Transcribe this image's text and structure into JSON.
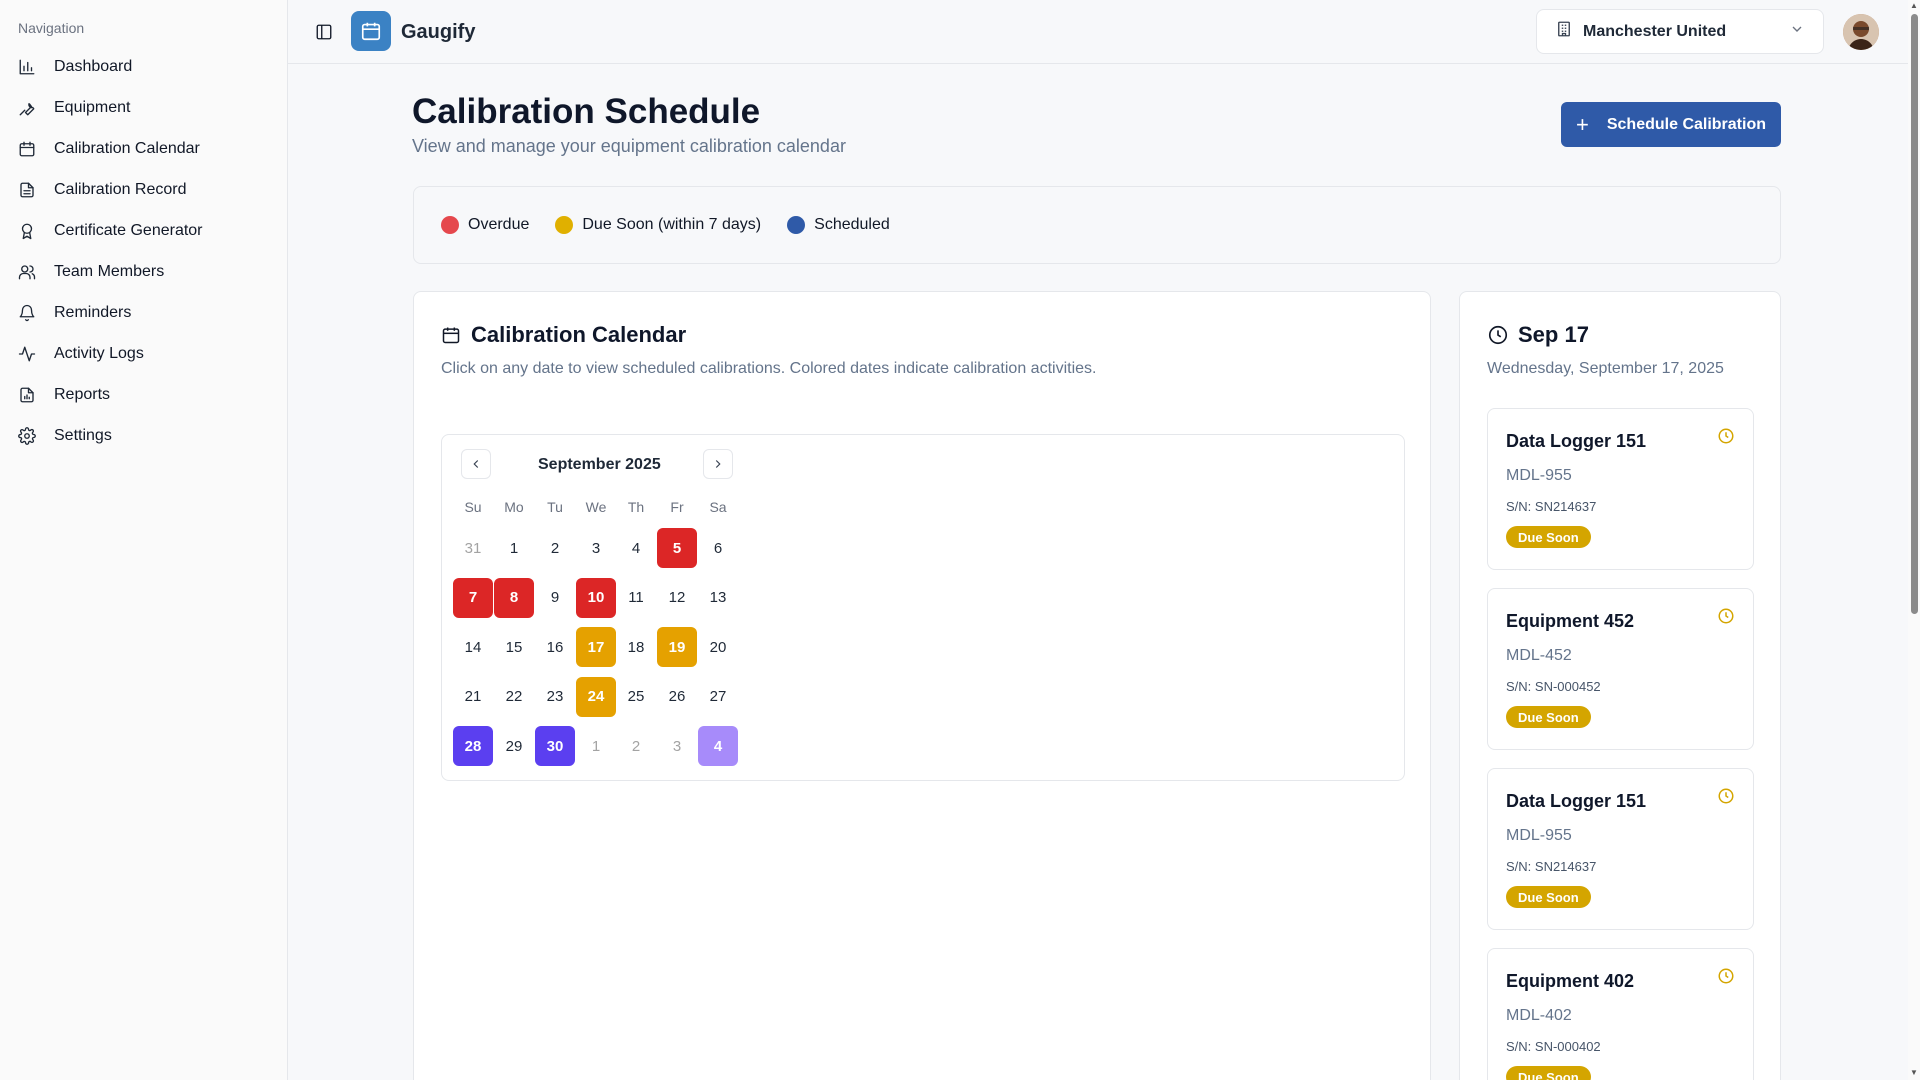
{
  "sidebar": {
    "heading": "Navigation",
    "items": [
      {
        "label": "Dashboard",
        "icon": "bar-chart-icon"
      },
      {
        "label": "Equipment",
        "icon": "wrench-icon"
      },
      {
        "label": "Calibration Calendar",
        "icon": "calendar-icon"
      },
      {
        "label": "Calibration Record",
        "icon": "file-text-icon"
      },
      {
        "label": "Certificate Generator",
        "icon": "award-icon"
      },
      {
        "label": "Team Members",
        "icon": "users-icon"
      },
      {
        "label": "Reminders",
        "icon": "bell-icon"
      },
      {
        "label": "Activity Logs",
        "icon": "activity-icon"
      },
      {
        "label": "Reports",
        "icon": "report-icon"
      },
      {
        "label": "Settings",
        "icon": "gear-icon"
      }
    ]
  },
  "header": {
    "app_name": "Gaugify",
    "organization": "Manchester United"
  },
  "page": {
    "title": "Calibration Schedule",
    "subtitle": "View and manage your equipment calibration calendar",
    "primary_action": "Schedule Calibration"
  },
  "legend": [
    {
      "label": "Overdue",
      "color": "#e5484d"
    },
    {
      "label": "Due Soon (within 7 days)",
      "color": "#e0b000"
    },
    {
      "label": "Scheduled",
      "color": "#2f5aa8"
    }
  ],
  "calendar": {
    "title": "Calibration Calendar",
    "description": "Click on any date to view scheduled calibrations. Colored dates indicate calibration activities.",
    "month": "September 2025",
    "weekdays": [
      "Su",
      "Mo",
      "Tu",
      "We",
      "Th",
      "Fr",
      "Sa"
    ],
    "colors": {
      "overdue": "#dc2626",
      "due_soon": "#e5a100",
      "scheduled": "#5b3ff0",
      "scheduled_outside": "#a78bfa"
    },
    "weeks": [
      [
        {
          "d": "31",
          "m": true
        },
        {
          "d": "1"
        },
        {
          "d": "2"
        },
        {
          "d": "3"
        },
        {
          "d": "4"
        },
        {
          "d": "5",
          "s": "overdue"
        },
        {
          "d": "6"
        }
      ],
      [
        {
          "d": "7",
          "s": "overdue"
        },
        {
          "d": "8",
          "s": "overdue"
        },
        {
          "d": "9"
        },
        {
          "d": "10",
          "s": "overdue"
        },
        {
          "d": "11"
        },
        {
          "d": "12"
        },
        {
          "d": "13"
        }
      ],
      [
        {
          "d": "14"
        },
        {
          "d": "15"
        },
        {
          "d": "16"
        },
        {
          "d": "17",
          "s": "due_soon"
        },
        {
          "d": "18"
        },
        {
          "d": "19",
          "s": "due_soon"
        },
        {
          "d": "20"
        }
      ],
      [
        {
          "d": "21"
        },
        {
          "d": "22"
        },
        {
          "d": "23"
        },
        {
          "d": "24",
          "s": "due_soon"
        },
        {
          "d": "25"
        },
        {
          "d": "26"
        },
        {
          "d": "27"
        }
      ],
      [
        {
          "d": "28",
          "s": "scheduled"
        },
        {
          "d": "29"
        },
        {
          "d": "30",
          "s": "scheduled"
        },
        {
          "d": "1",
          "m": true
        },
        {
          "d": "2",
          "m": true
        },
        {
          "d": "3",
          "m": true
        },
        {
          "d": "4",
          "m": true,
          "s": "scheduled_outside"
        }
      ]
    ]
  },
  "selected_day": {
    "title": "Sep 17",
    "date": "Wednesday, September 17, 2025",
    "items": [
      {
        "name": "Data Logger 151",
        "model": "MDL-955",
        "serial": "S/N: SN214637",
        "status": "Due Soon"
      },
      {
        "name": "Equipment 452",
        "model": "MDL-452",
        "serial": "S/N: SN-000452",
        "status": "Due Soon"
      },
      {
        "name": "Data Logger 151",
        "model": "MDL-955",
        "serial": "S/N: SN214637",
        "status": "Due Soon"
      },
      {
        "name": "Equipment 402",
        "model": "MDL-402",
        "serial": "S/N: SN-000402",
        "status": "Due Soon"
      }
    ]
  }
}
